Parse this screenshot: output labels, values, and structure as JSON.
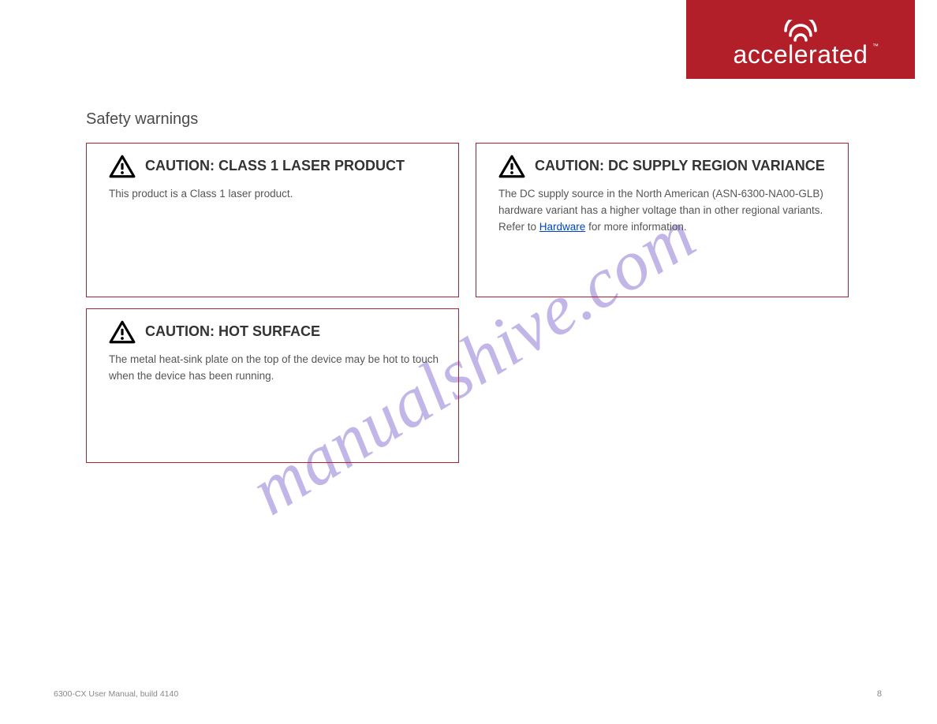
{
  "brand": {
    "name": "accelerated",
    "tm": "™"
  },
  "page_title": "Safety warnings",
  "watermark": "manualshive.com",
  "cautions": [
    {
      "id": "class1",
      "heading": "CAUTION: CLASS 1 LASER PRODUCT",
      "body": "This product is a Class 1 laser product."
    },
    {
      "id": "dc-supply",
      "heading": "CAUTION: DC SUPPLY REGION VARIANCE",
      "body_prefix": "The DC supply source in the North American (ASN-6300-NA00-GLB) hardware variant has a higher voltage than in other regional variants. Refer to ",
      "body_link": "Hardware",
      "body_suffix": " for more information."
    },
    {
      "id": "hot-surface",
      "heading": "CAUTION: HOT SURFACE",
      "body": "The metal heat-sink plate on the top of the device may be hot to touch when the device has been running."
    }
  ],
  "footer": {
    "doc": "6300-CX User Manual, build 4140",
    "page": "8"
  }
}
